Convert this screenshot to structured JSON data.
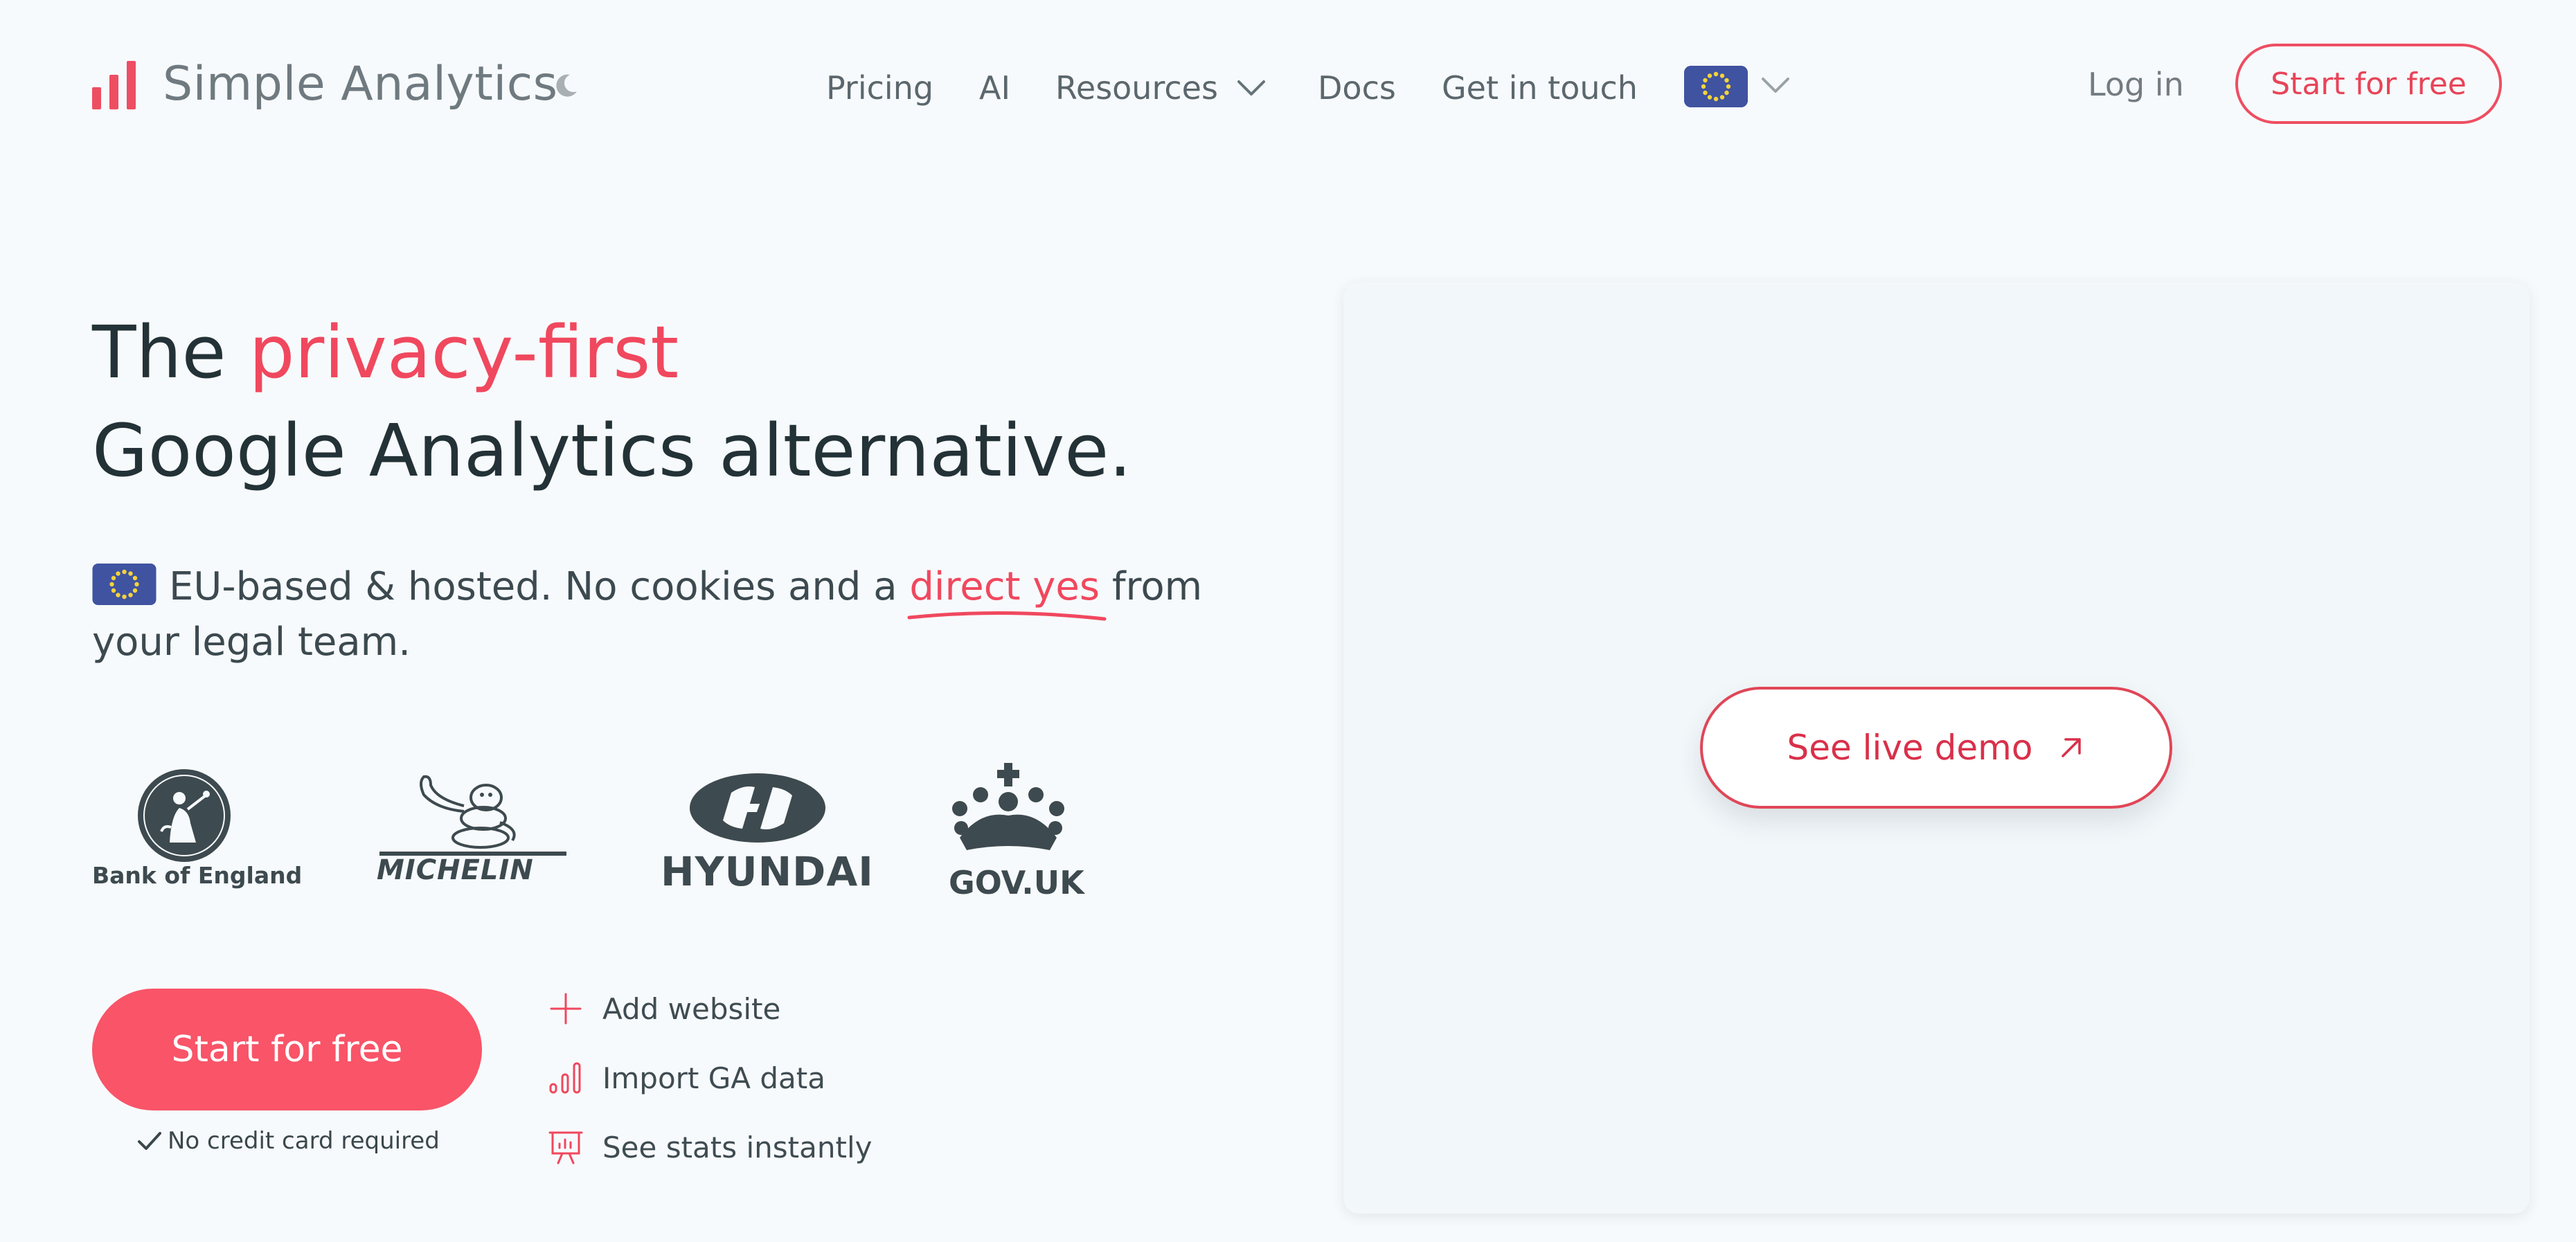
{
  "header": {
    "brand": "Simple Analytics",
    "nav": {
      "pricing": "Pricing",
      "ai": "AI",
      "resources": "Resources",
      "docs": "Docs",
      "contact": "Get in touch"
    },
    "login": "Log in",
    "cta": "Start for free"
  },
  "hero": {
    "title_prefix": "The",
    "title_accent": "privacy-first",
    "title_line2": "Google Analytics alternative.",
    "subtitle_part1": "EU-based & hosted. No cookies and a",
    "subtitle_accent": "direct yes",
    "subtitle_part2": "from your legal team."
  },
  "logos": {
    "boe": "Bank of England",
    "michelin": "MICHELIN",
    "hyundai": "HYUNDAI",
    "gov": "GOV.UK"
  },
  "cta": {
    "button": "Start for free",
    "note": "No credit card required"
  },
  "steps": [
    "Add website",
    "Import GA data",
    "See stats instantly"
  ],
  "demo": {
    "button": "See live demo"
  },
  "colors": {
    "accent": "#f0485e",
    "cta_fill": "#f95468",
    "text_dark": "#233236",
    "eu_blue": "#3f53a0",
    "eu_star": "#f5d33a"
  },
  "icons": [
    "bar-chart-icon",
    "moon-icon",
    "chevron-down-icon",
    "eu-flag-icon",
    "check-icon",
    "plus-icon",
    "chart-icon",
    "presentation-icon",
    "arrow-up-right-icon"
  ]
}
